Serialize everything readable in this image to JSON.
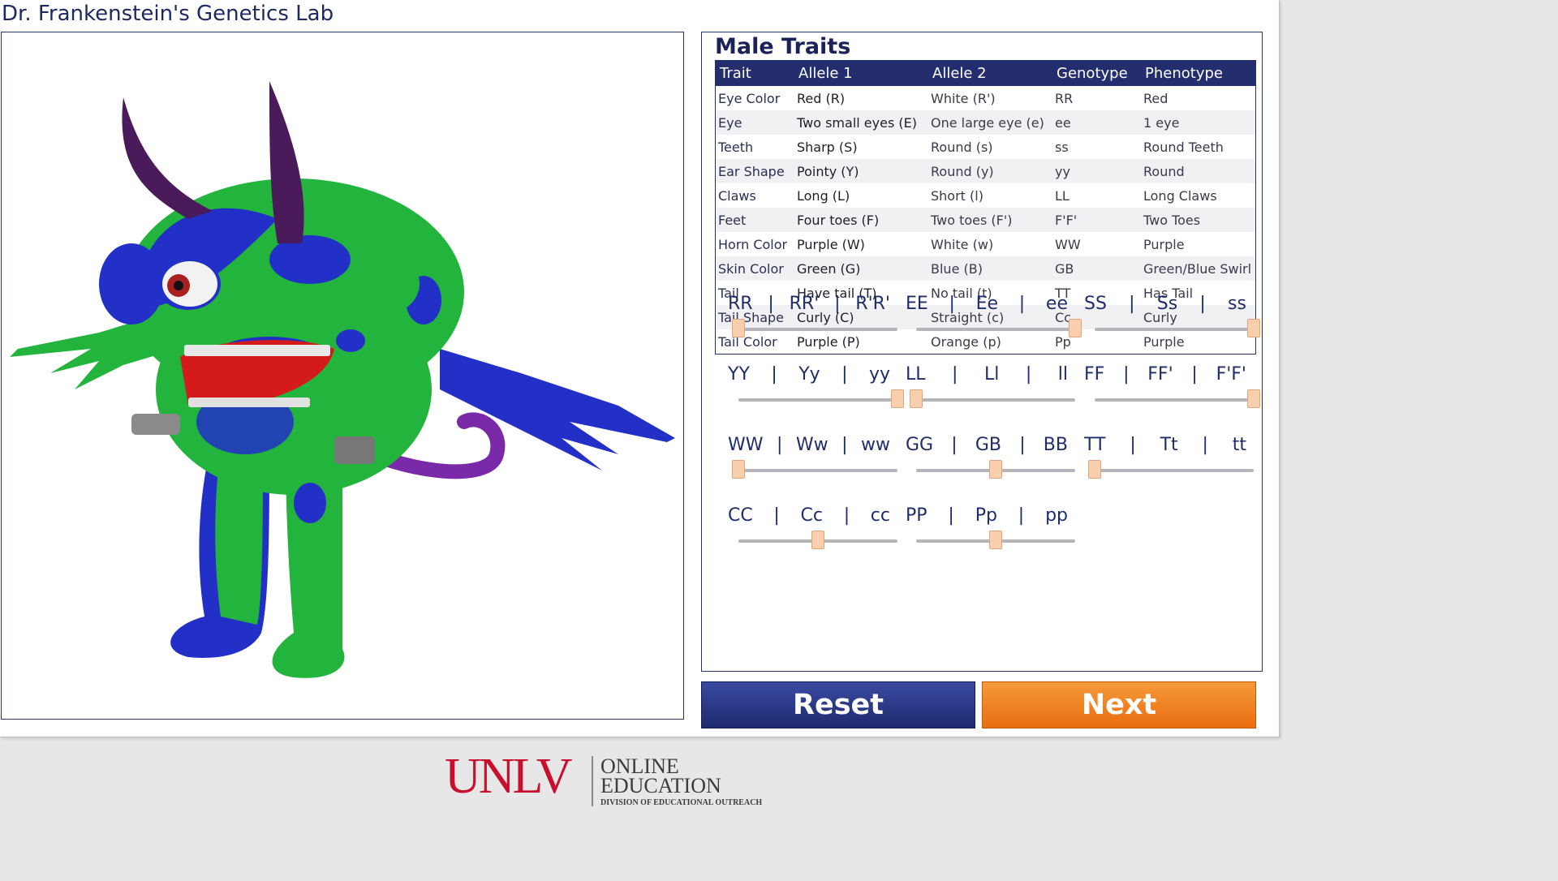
{
  "app": {
    "title": "Dr. Frankenstein's Genetics Lab"
  },
  "traits": {
    "heading": "Male Traits",
    "columns": [
      "Trait",
      "Allele 1",
      "Allele 2",
      "Genotype",
      "Phenotype"
    ],
    "rows": [
      [
        "Eye Color",
        "Red (R)",
        "White (R')",
        "RR",
        "Red"
      ],
      [
        "Eye",
        "Two small eyes (E)",
        "One large eye (e)",
        "ee",
        "1 eye"
      ],
      [
        "Teeth",
        "Sharp (S)",
        "Round (s)",
        "ss",
        "Round Teeth"
      ],
      [
        "Ear Shape",
        "Pointy (Y)",
        "Round (y)",
        "yy",
        "Round"
      ],
      [
        "Claws",
        "Long (L)",
        "Short (l)",
        "LL",
        "Long Claws"
      ],
      [
        "Feet",
        "Four toes (F)",
        "Two toes (F')",
        "F'F'",
        "Two Toes"
      ],
      [
        "Horn Color",
        "Purple (W)",
        "White (w)",
        "WW",
        "Purple"
      ],
      [
        "Skin Color",
        "Green (G)",
        "Blue (B)",
        "GB",
        "Green/Blue Swirl"
      ],
      [
        "Tail",
        "Have tail (T)",
        "No tail (t)",
        "TT",
        "Has Tail"
      ],
      [
        "Tail Shape",
        "Curly (C)",
        "Straight (c)",
        "Cc",
        "Curly"
      ],
      [
        "Tail Color",
        "Purple (P)",
        "Orange (p)",
        "Pp",
        "Purple"
      ]
    ]
  },
  "sliders": [
    {
      "id": "eye-color",
      "options": [
        "RR",
        "RR'",
        "R'R'"
      ],
      "selected": 0
    },
    {
      "id": "eye",
      "options": [
        "EE",
        "Ee",
        "ee"
      ],
      "selected": 2
    },
    {
      "id": "teeth",
      "options": [
        "SS",
        "Ss",
        "ss"
      ],
      "selected": 2
    },
    {
      "id": "ear-shape",
      "options": [
        "YY",
        "Yy",
        "yy"
      ],
      "selected": 2
    },
    {
      "id": "claws",
      "options": [
        "LL",
        "Ll",
        "ll"
      ],
      "selected": 0
    },
    {
      "id": "feet",
      "options": [
        "FF",
        "FF'",
        "F'F'"
      ],
      "selected": 2
    },
    {
      "id": "horn-color",
      "options": [
        "WW",
        "Ww",
        "ww"
      ],
      "selected": 0
    },
    {
      "id": "skin-color",
      "options": [
        "GG",
        "GB",
        "BB"
      ],
      "selected": 1
    },
    {
      "id": "tail",
      "options": [
        "TT",
        "Tt",
        "tt"
      ],
      "selected": 0
    },
    {
      "id": "tail-shape",
      "options": [
        "CC",
        "Cc",
        "cc"
      ],
      "selected": 1
    },
    {
      "id": "tail-color",
      "options": [
        "PP",
        "Pp",
        "pp"
      ],
      "selected": 1
    }
  ],
  "buttons": {
    "reset": "Reset",
    "next": "Next"
  },
  "footer": {
    "logo_unlv": "UNLV",
    "logo_online": "ONLINE",
    "logo_education": "EDUCATION",
    "logo_division": "DIVISION OF EDUCATIONAL OUTREACH"
  },
  "colors": {
    "navy": "#242e6e",
    "orange": "#ee7416",
    "creature_green": "#22b43c",
    "creature_blue": "#2230c8",
    "horn_purple": "#4a1a5a",
    "tail_purple": "#7a2aa8",
    "logo_red": "#c8102e"
  }
}
